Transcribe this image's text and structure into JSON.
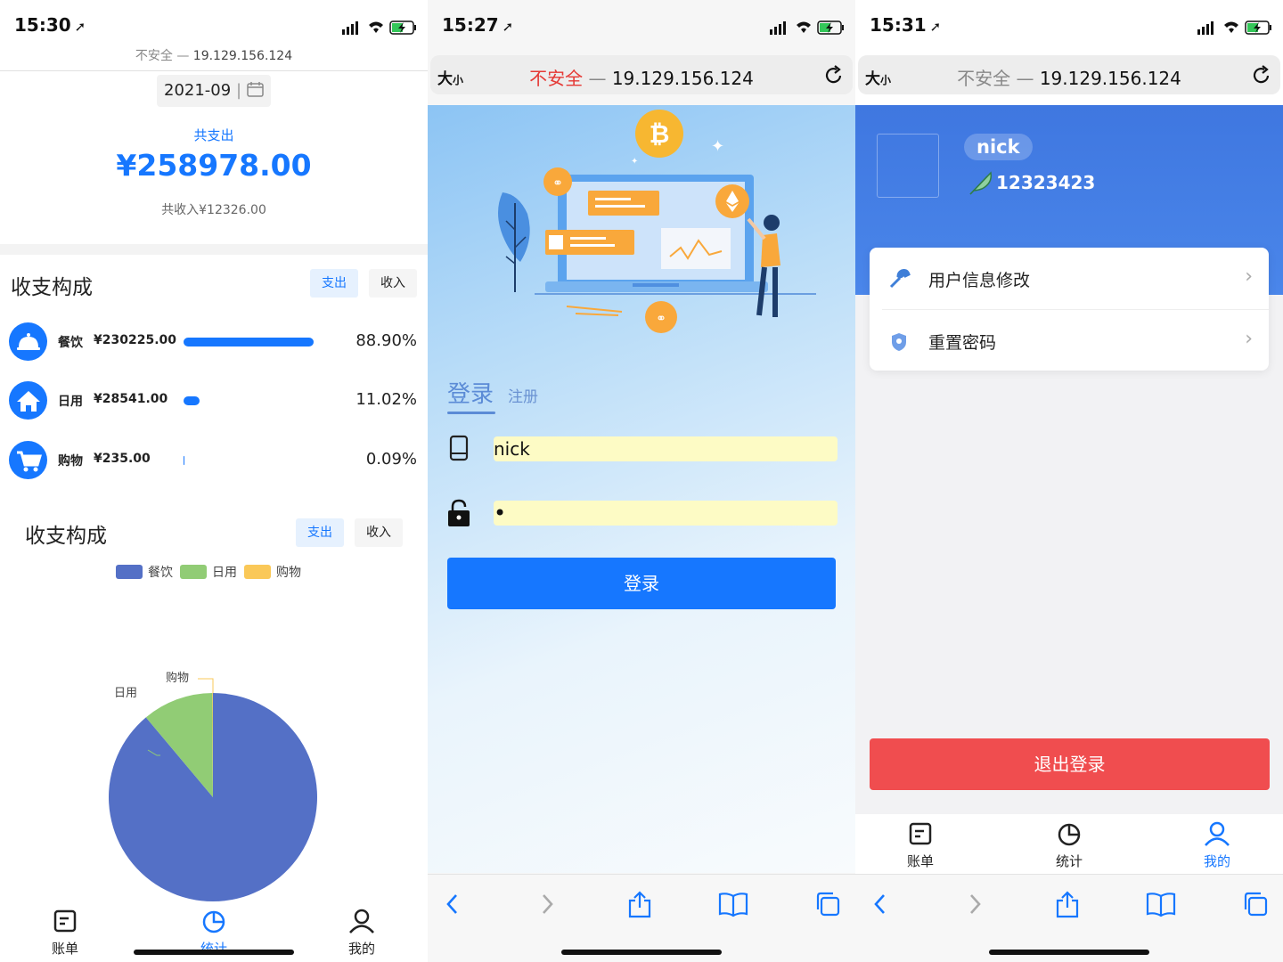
{
  "left": {
    "status": {
      "time": "15:30"
    },
    "address": {
      "unsafe": "不安全",
      "dash": "—",
      "host": "19.129.156.124"
    },
    "month_picker": {
      "value": "2021-09"
    },
    "summary": {
      "expense_label": "共支出",
      "expense_total": "¥258978.00",
      "income_total": "共收入¥12326.00"
    },
    "breakdown": {
      "title": "收支构成",
      "tabs": {
        "expense": "支出",
        "income": "收入"
      },
      "rows": [
        {
          "name": "餐饮",
          "amount": "¥230225.00",
          "percent_text": "88.90%",
          "percent": 88.9,
          "icon": "food-cover-icon"
        },
        {
          "name": "日用",
          "amount": "¥28541.00",
          "percent_text": "11.02%",
          "percent": 11.02,
          "icon": "house-icon"
        },
        {
          "name": "购物",
          "amount": "¥235.00",
          "percent_text": "0.09%",
          "percent": 0.09,
          "icon": "shopping-cart-icon"
        }
      ]
    },
    "pie_section": {
      "title": "收支构成",
      "tabs": {
        "expense": "支出",
        "income": "收入"
      },
      "legend": [
        {
          "name": "餐饮",
          "color": "#5470c6"
        },
        {
          "name": "日用",
          "color": "#91cc75"
        },
        {
          "name": "购物",
          "color": "#fac858"
        }
      ],
      "labels": {
        "daily": "日用",
        "shopping": "购物"
      }
    },
    "tabbar": {
      "bill": "账单",
      "stats": "统计",
      "mine": "我的"
    }
  },
  "chart_data": {
    "type": "pie",
    "categories": [
      "餐饮",
      "日用",
      "购物"
    ],
    "values": [
      230225.0,
      28541.0,
      235.0
    ],
    "colors": [
      "#5470c6",
      "#91cc75",
      "#fac858"
    ],
    "title": "收支构成",
    "legend_position": "top"
  },
  "middle": {
    "status": {
      "time": "15:27"
    },
    "address": {
      "aa": "大",
      "aa_small": "小",
      "unsafe": "不安全",
      "dash": "—",
      "host": "19.129.156.124"
    },
    "login": {
      "tab_login": "登录",
      "tab_register": "注册",
      "username": "nick",
      "password_mask": "•",
      "submit": "登录"
    }
  },
  "right": {
    "status": {
      "time": "15:31"
    },
    "address": {
      "aa": "大",
      "aa_small": "小",
      "unsafe": "不安全",
      "dash": "—",
      "host": "19.129.156.124"
    },
    "profile": {
      "name": "nick",
      "uid": "12323423"
    },
    "menu": [
      {
        "label": "用户信息修改",
        "icon": "wrench-icon"
      },
      {
        "label": "重置密码",
        "icon": "shield-icon"
      }
    ],
    "logout": "退出登录",
    "tabbar": {
      "bill": "账单",
      "stats": "统计",
      "mine": "我的"
    }
  }
}
